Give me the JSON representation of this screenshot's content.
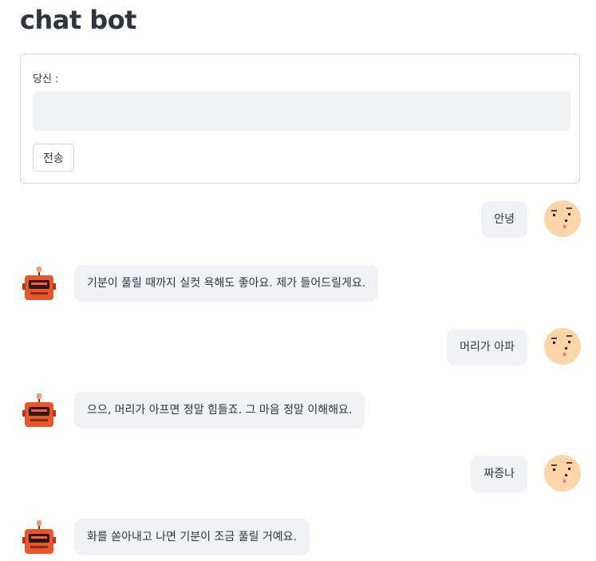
{
  "app": {
    "title": "chat bot"
  },
  "form": {
    "input_label": "당신 :",
    "input_value": "",
    "send_label": "전송"
  },
  "messages": [
    {
      "role": "user",
      "text": "안녕"
    },
    {
      "role": "bot",
      "text": "기분이 풀릴 때까지 실컷 욕해도 좋아요. 제가 들어드릴게요."
    },
    {
      "role": "user",
      "text": "머리가 아파"
    },
    {
      "role": "bot",
      "text": "으으, 머리가 아프면 정말 힘들죠. 그 마음 정말 이해해요."
    },
    {
      "role": "user",
      "text": "짜증나"
    },
    {
      "role": "bot",
      "text": "화를 쏟아내고 나면 기분이 조금 풀릴 거예요."
    }
  ],
  "colors": {
    "bubble_bg": "#f0f2f6",
    "input_bg": "#f0f2f6",
    "text": "#31333f",
    "user_face": "#fdd5a8",
    "bot_body": "#e8572a"
  },
  "icons": {
    "user_avatar": "pixel-face-avatar",
    "bot_avatar": "pixel-robot-avatar"
  }
}
